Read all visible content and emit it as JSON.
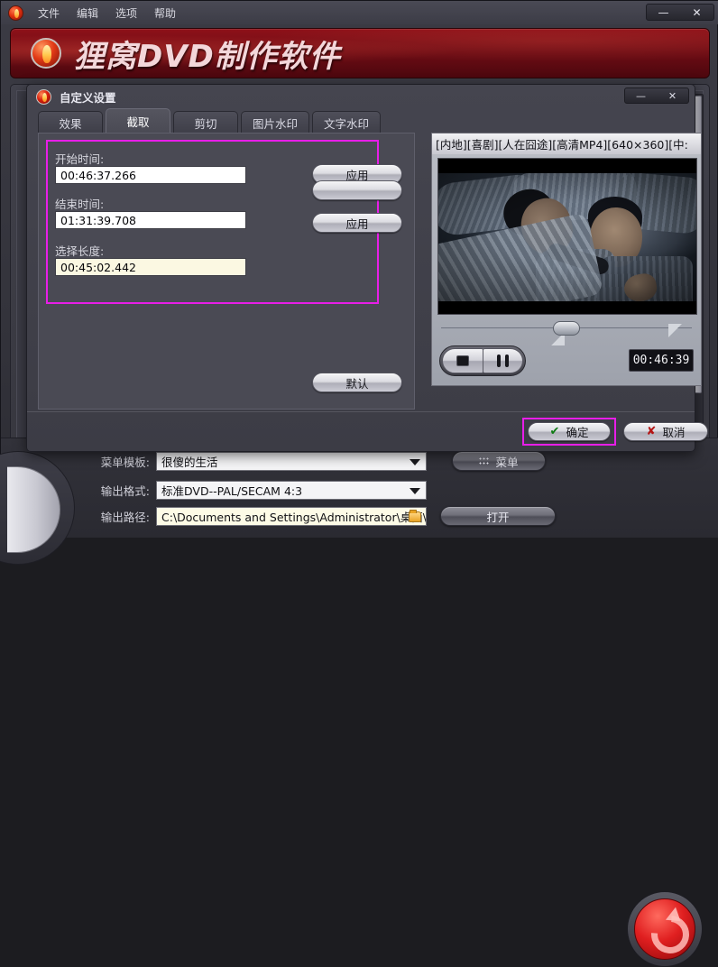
{
  "app": {
    "logo_icon": "flame-logo-icon",
    "menu": [
      {
        "label": "文件"
      },
      {
        "label": "编辑"
      },
      {
        "label": "选项"
      },
      {
        "label": "帮助"
      }
    ],
    "window_buttons": {
      "minimize": "—",
      "close": "✕"
    },
    "banner_title": "狸窝DVD制作软件"
  },
  "bottom_settings": {
    "rows": [
      {
        "label": "菜单模板:",
        "value": "很傻的生活",
        "button": "菜单"
      },
      {
        "label": "输出格式:",
        "value": "标准DVD--PAL/SECAM 4:3",
        "button": ""
      },
      {
        "label": "输出路径:",
        "value": "C:\\Documents and Settings\\Administrator\\桌面\\",
        "button": "打开"
      }
    ],
    "burn_button_icon": "burn-arrow-icon"
  },
  "dialog": {
    "title": "自定义设置",
    "logo_icon": "flame-logo-icon",
    "window_buttons": {
      "minimize": "—",
      "close": "✕"
    },
    "tabs": [
      {
        "label": "效果",
        "active": false
      },
      {
        "label": "截取",
        "active": true
      },
      {
        "label": "剪切",
        "active": false
      },
      {
        "label": "图片水印",
        "active": false
      },
      {
        "label": "文字水印",
        "active": false
      }
    ],
    "trim_panel": {
      "highlight_color": "#e81ee8",
      "start_label": "开始时间:",
      "start_value": "00:46:37.266",
      "start_apply_button": "应用",
      "end_label": "结束时间:",
      "end_value": "01:31:39.708",
      "end_apply_button": "应用",
      "length_label": "选择长度:",
      "length_value": "00:45:02.442",
      "default_button": "默认"
    },
    "preview": {
      "video_title": "[内地][喜剧][人在囧途][高清MP4][640×360][中:",
      "stop_icon": "stop-icon",
      "pause_icon": "pause-icon",
      "timecode": "00:46:39",
      "slider_thumb_icon": "slider-thumb-icon",
      "marker_start_icon": "trim-start-marker-icon",
      "marker_end_icon": "trim-end-marker-icon"
    },
    "footer": {
      "ok_label": "确定",
      "ok_icon": "check-icon",
      "ok_highlight_color": "#e81ee8",
      "cancel_label": "取消",
      "cancel_icon": "x-icon"
    }
  }
}
